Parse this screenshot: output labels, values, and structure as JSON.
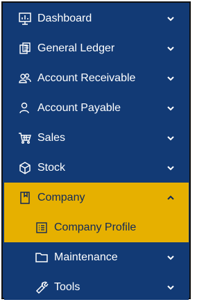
{
  "menu": {
    "items": [
      {
        "label": "Dashboard",
        "icon": "presentation-chart-icon",
        "expanded": false
      },
      {
        "label": "General Ledger",
        "icon": "ledger-icon",
        "expanded": false
      },
      {
        "label": "Account Receivable",
        "icon": "users-icon",
        "expanded": false
      },
      {
        "label": "Account Payable",
        "icon": "user-icon",
        "expanded": false
      },
      {
        "label": "Sales",
        "icon": "cart-icon",
        "expanded": false
      },
      {
        "label": "Stock",
        "icon": "box-icon",
        "expanded": false
      },
      {
        "label": "Company",
        "icon": "bookmark-icon",
        "expanded": true
      }
    ],
    "company_children": [
      {
        "label": "Company Profile",
        "icon": "list-icon"
      },
      {
        "label": "Maintenance",
        "icon": "folder-icon"
      },
      {
        "label": "Tools",
        "icon": "wrench-icon"
      }
    ]
  },
  "colors": {
    "sidebar_bg": "#123a75",
    "active_bg": "#e6b000",
    "text": "#ffffff",
    "active_text": "#10295a"
  }
}
